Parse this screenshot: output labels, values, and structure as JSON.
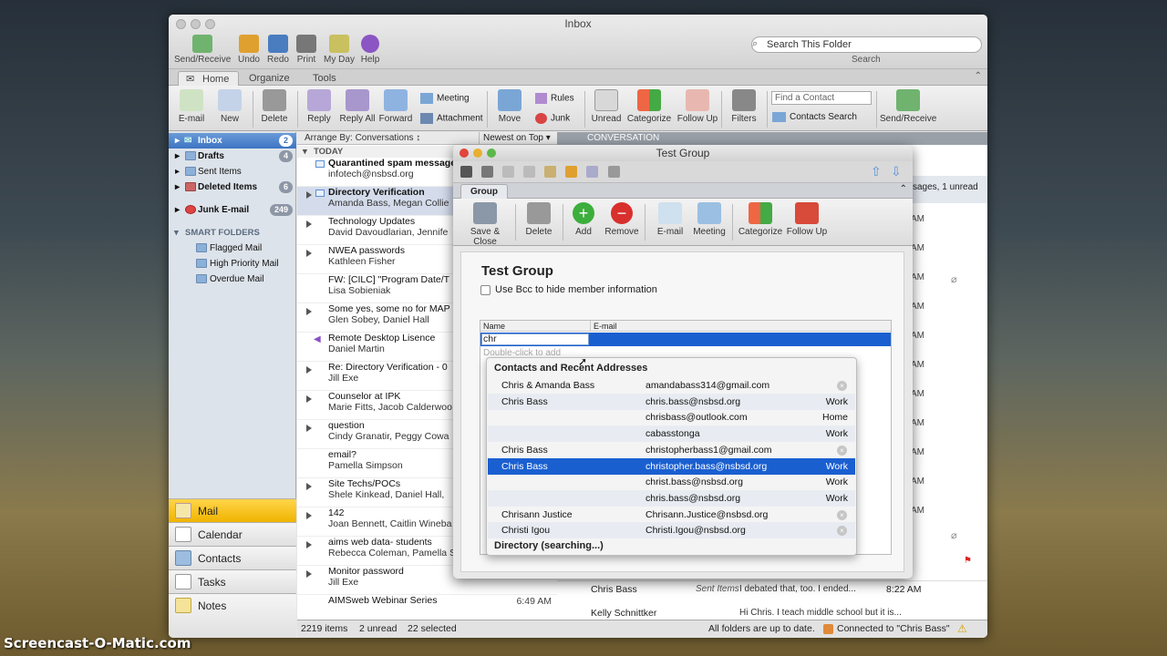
{
  "window": {
    "title": "Inbox"
  },
  "toolbar": {
    "items": [
      "Send/Receive",
      "Undo",
      "Redo",
      "Print",
      "My Day",
      "Help"
    ]
  },
  "search": {
    "placeholder": "Search This Folder",
    "caption": "Search"
  },
  "tabs": [
    "Home",
    "Organize",
    "Tools"
  ],
  "ribbon": {
    "email": "E-mail",
    "new": "New",
    "delete": "Delete",
    "reply": "Reply",
    "reply_all": "Reply All",
    "forward": "Forward",
    "meeting": "Meeting",
    "attachment": "Attachment",
    "move": "Move",
    "rules": "Rules",
    "junk": "Junk",
    "unread": "Unread",
    "categorize": "Categorize",
    "follow_up": "Follow Up",
    "filters": "Filters",
    "find_contact": "Find a Contact",
    "contacts_search": "Contacts Search",
    "send_receive": "Send/Receive"
  },
  "sidebar": {
    "folders": [
      {
        "label": "Inbox",
        "count": "2"
      },
      {
        "label": "Drafts",
        "count": "4"
      },
      {
        "label": "Sent Items",
        "count": ""
      },
      {
        "label": "Deleted Items",
        "count": "6"
      },
      {
        "label": "Junk E-mail",
        "count": "249"
      }
    ],
    "smart_header": "SMART FOLDERS",
    "smart": [
      "Flagged Mail",
      "High Priority Mail",
      "Overdue Mail"
    ],
    "nav": [
      "Mail",
      "Calendar",
      "Contacts",
      "Tasks",
      "Notes"
    ]
  },
  "list": {
    "arrange": "Arrange By: Conversations",
    "sort": "Newest on Top",
    "conversation": "CONVERSATION",
    "today": "TODAY",
    "messages": [
      {
        "subject": "Quarantined spam message",
        "from": "infotech@nsbsd.org"
      },
      {
        "subject": "Directory Verification",
        "from": "Amanda Bass, Megan Collie"
      },
      {
        "subject": "Technology Updates",
        "from": "David Davoudlarian, Jennife"
      },
      {
        "subject": "NWEA passwords",
        "from": "Kathleen Fisher"
      },
      {
        "subject": "FW: [CILC] \"Program Date/T",
        "from": "Lisa Sobieniak"
      },
      {
        "subject": "Some yes, some no for MAP",
        "from": "Glen Sobey, Daniel Hall"
      },
      {
        "subject": "Remote Desktop Lisence",
        "from": "Daniel Martin"
      },
      {
        "subject": "Re: Directory Verification - 0",
        "from": "Jill Exe"
      },
      {
        "subject": "Counselor at IPK",
        "from": "Marie Fitts, Jacob Calderwoo"
      },
      {
        "subject": "question",
        "from": "Cindy Granatir, Peggy Cowa"
      },
      {
        "subject": "email?",
        "from": "Pamella Simpson"
      },
      {
        "subject": "Site Techs/POCs",
        "from": "Shele Kinkead, Daniel Hall,"
      },
      {
        "subject": "142",
        "from": "Joan Bennett, Caitlin Wineba"
      },
      {
        "subject": "aims web data- students",
        "from": "Rebecca Coleman, Pamella S"
      },
      {
        "subject": "Monitor password",
        "from": "Jill Exe"
      },
      {
        "subject": "AIMSweb Webinar Series",
        "from": "",
        "time": "6:49 AM"
      }
    ]
  },
  "reading": {
    "unread_tail": "ssages, 1 unread",
    "times": [
      "AM",
      "AM",
      "AM",
      "AM",
      "AM",
      "AM",
      "AM",
      "AM",
      "AM",
      "AM",
      "AM"
    ],
    "bottom_from": "Chris Bass",
    "bottom_folder": "Sent Items",
    "bottom_preview": "I debated that, too. I ended...",
    "bottom_time": "8:22 AM",
    "bottom2_from": "Kelly Schnittker",
    "bottom2_preview": "Hi Chris. I teach middle school but it is..."
  },
  "status": {
    "items": "2219 items",
    "unread": "2 unread",
    "selected": "22 selected",
    "sync": "All folders are up to date.",
    "connected": "Connected to \"Chris Bass\""
  },
  "dialog": {
    "title": "Test Group",
    "tab": "Group",
    "ribbon": [
      "Save & Close",
      "Delete",
      "Add",
      "Remove",
      "E-mail",
      "Meeting",
      "Categorize",
      "Follow Up"
    ],
    "heading": "Test Group",
    "bcc": "Use Bcc to hide member information",
    "col_name": "Name",
    "col_email": "E-mail",
    "input_value": "chr",
    "hint": "Double-click to add"
  },
  "popup": {
    "header": "Contacts and Recent Addresses",
    "rows": [
      {
        "name": "Chris & Amanda Bass",
        "email": "amandabass314@gmail.com",
        "kind": "",
        "x": true
      },
      {
        "name": "Chris Bass",
        "email": "chris.bass@nsbsd.org",
        "kind": "Work",
        "x": false
      },
      {
        "name": "",
        "email": "chrisbass@outlook.com",
        "kind": "Home",
        "x": false
      },
      {
        "name": "",
        "email": "cabasstonga",
        "kind": "Work",
        "x": false
      },
      {
        "name": "Chris Bass",
        "email": "christopherbass1@gmail.com",
        "kind": "",
        "x": true
      },
      {
        "name": "Chris Bass",
        "email": "christopher.bass@nsbsd.org",
        "kind": "Work",
        "x": false
      },
      {
        "name": "",
        "email": "christ.bass@nsbsd.org",
        "kind": "Work",
        "x": false
      },
      {
        "name": "",
        "email": "chris.bass@nsbsd.org",
        "kind": "Work",
        "x": false
      },
      {
        "name": "Chrisann Justice",
        "email": "Chrisann.Justice@nsbsd.org",
        "kind": "",
        "x": true
      },
      {
        "name": "Christi Igou",
        "email": "Christi.Igou@nsbsd.org",
        "kind": "",
        "x": true
      }
    ],
    "footer": "Directory (searching...)"
  },
  "watermark": "Screencast-O-Matic.com"
}
